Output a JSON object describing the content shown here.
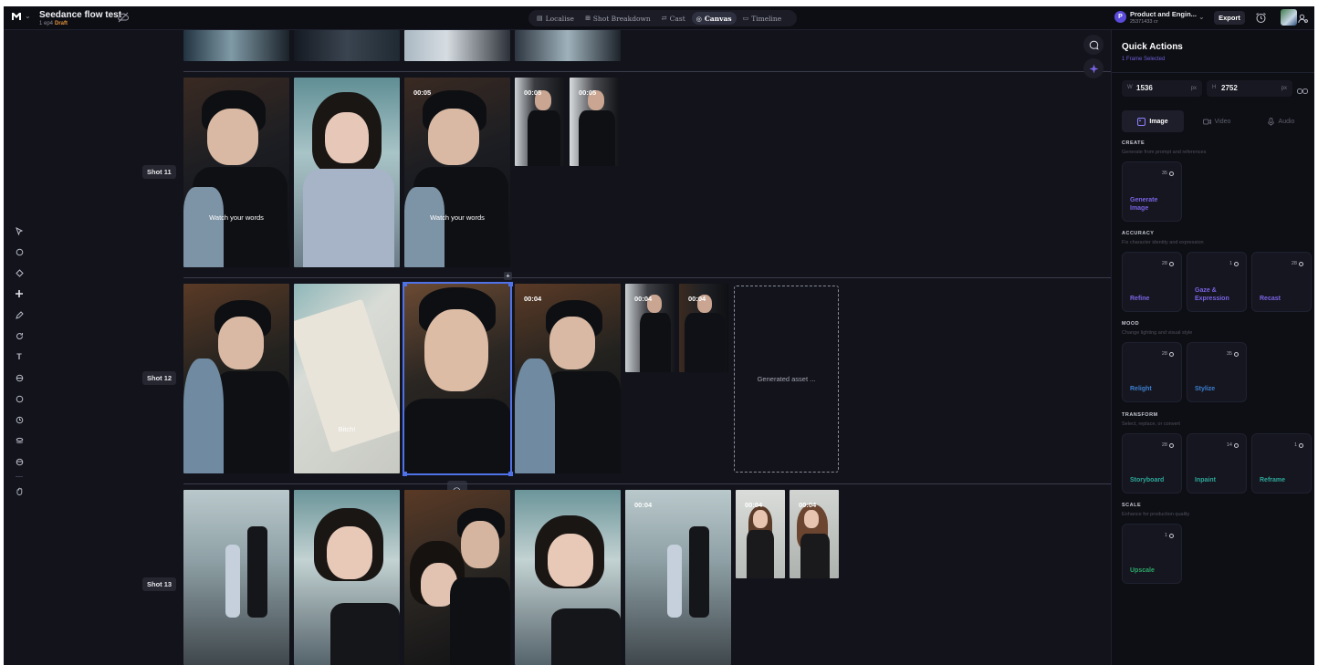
{
  "app": {
    "project_title": "Seedance flow test",
    "project_meta": "1 ep4",
    "project_status": "Draft"
  },
  "nav": {
    "tabs": [
      {
        "label": "Localise",
        "icon": "document-icon"
      },
      {
        "label": "Shot Breakdown",
        "icon": "grid-icon"
      },
      {
        "label": "Cast",
        "icon": "swap-icon"
      },
      {
        "label": "Canvas",
        "icon": "canvas-icon",
        "active": true
      },
      {
        "label": "Timeline",
        "icon": "timeline-icon"
      }
    ]
  },
  "org": {
    "initial": "P",
    "name": "Product and Engin...",
    "id": "25371433 cr"
  },
  "header": {
    "export_label": "Export"
  },
  "canvas": {
    "shots": [
      {
        "label": "Shot 11"
      },
      {
        "label": "Shot 12"
      },
      {
        "label": "Shot 13"
      }
    ],
    "durations": {
      "s11_f3": "00:05",
      "s11_t1": "00:05",
      "s11_t2": "00:05",
      "s12_f4": "00:04",
      "s12_t1": "00:04",
      "s12_t2": "00:04",
      "s13_f5": "00:04",
      "s13_t1": "00:04",
      "s13_t2": "00:04"
    },
    "captions": {
      "s11_f1": "Watch your words",
      "s11_f3": "Watch your words",
      "s12_f2": "Bitch!"
    },
    "generated_placeholder": "Generated asset ..."
  },
  "panel": {
    "title": "Quick Actions",
    "subtitle": "1 Frame Selected",
    "width": {
      "key": "W",
      "value": "1536",
      "unit": "px"
    },
    "height": {
      "key": "H",
      "value": "2752",
      "unit": "px"
    },
    "modes": [
      {
        "label": "Image",
        "active": true
      },
      {
        "label": "Video"
      },
      {
        "label": "Audio"
      }
    ],
    "sections": {
      "create": {
        "title": "CREATE",
        "desc": "Generate from prompt and references",
        "cards": [
          {
            "label": "Generate Image",
            "cost": "35",
            "color": "#7b64e6"
          }
        ]
      },
      "accuracy": {
        "title": "ACCURACY",
        "desc": "Fix character identity and expression",
        "cards": [
          {
            "label": "Refine",
            "cost": "28",
            "color": "#7b64e6"
          },
          {
            "label": "Gaze & Expression",
            "cost": "1",
            "color": "#7b64e6"
          },
          {
            "label": "Recast",
            "cost": "28",
            "color": "#7b64e6"
          }
        ]
      },
      "mood": {
        "title": "MOOD",
        "desc": "Change lighting and visual style",
        "cards": [
          {
            "label": "Relight",
            "cost": "28",
            "color": "#3c7fd1"
          },
          {
            "label": "Stylize",
            "cost": "35",
            "color": "#3c7fd1"
          }
        ]
      },
      "transform": {
        "title": "TRANSFORM",
        "desc": "Select, replace, or convert",
        "cards": [
          {
            "label": "Storyboard",
            "cost": "28",
            "color": "#2ea89a"
          },
          {
            "label": "Inpaint",
            "cost": "14",
            "color": "#2ea89a"
          },
          {
            "label": "Reframe",
            "cost": "1",
            "color": "#2ea89a"
          }
        ]
      },
      "scale": {
        "title": "SCALE",
        "desc": "Enhance for production quality",
        "cards": [
          {
            "label": "Upscale",
            "cost": "1",
            "color": "#2ea86a"
          }
        ]
      }
    }
  }
}
